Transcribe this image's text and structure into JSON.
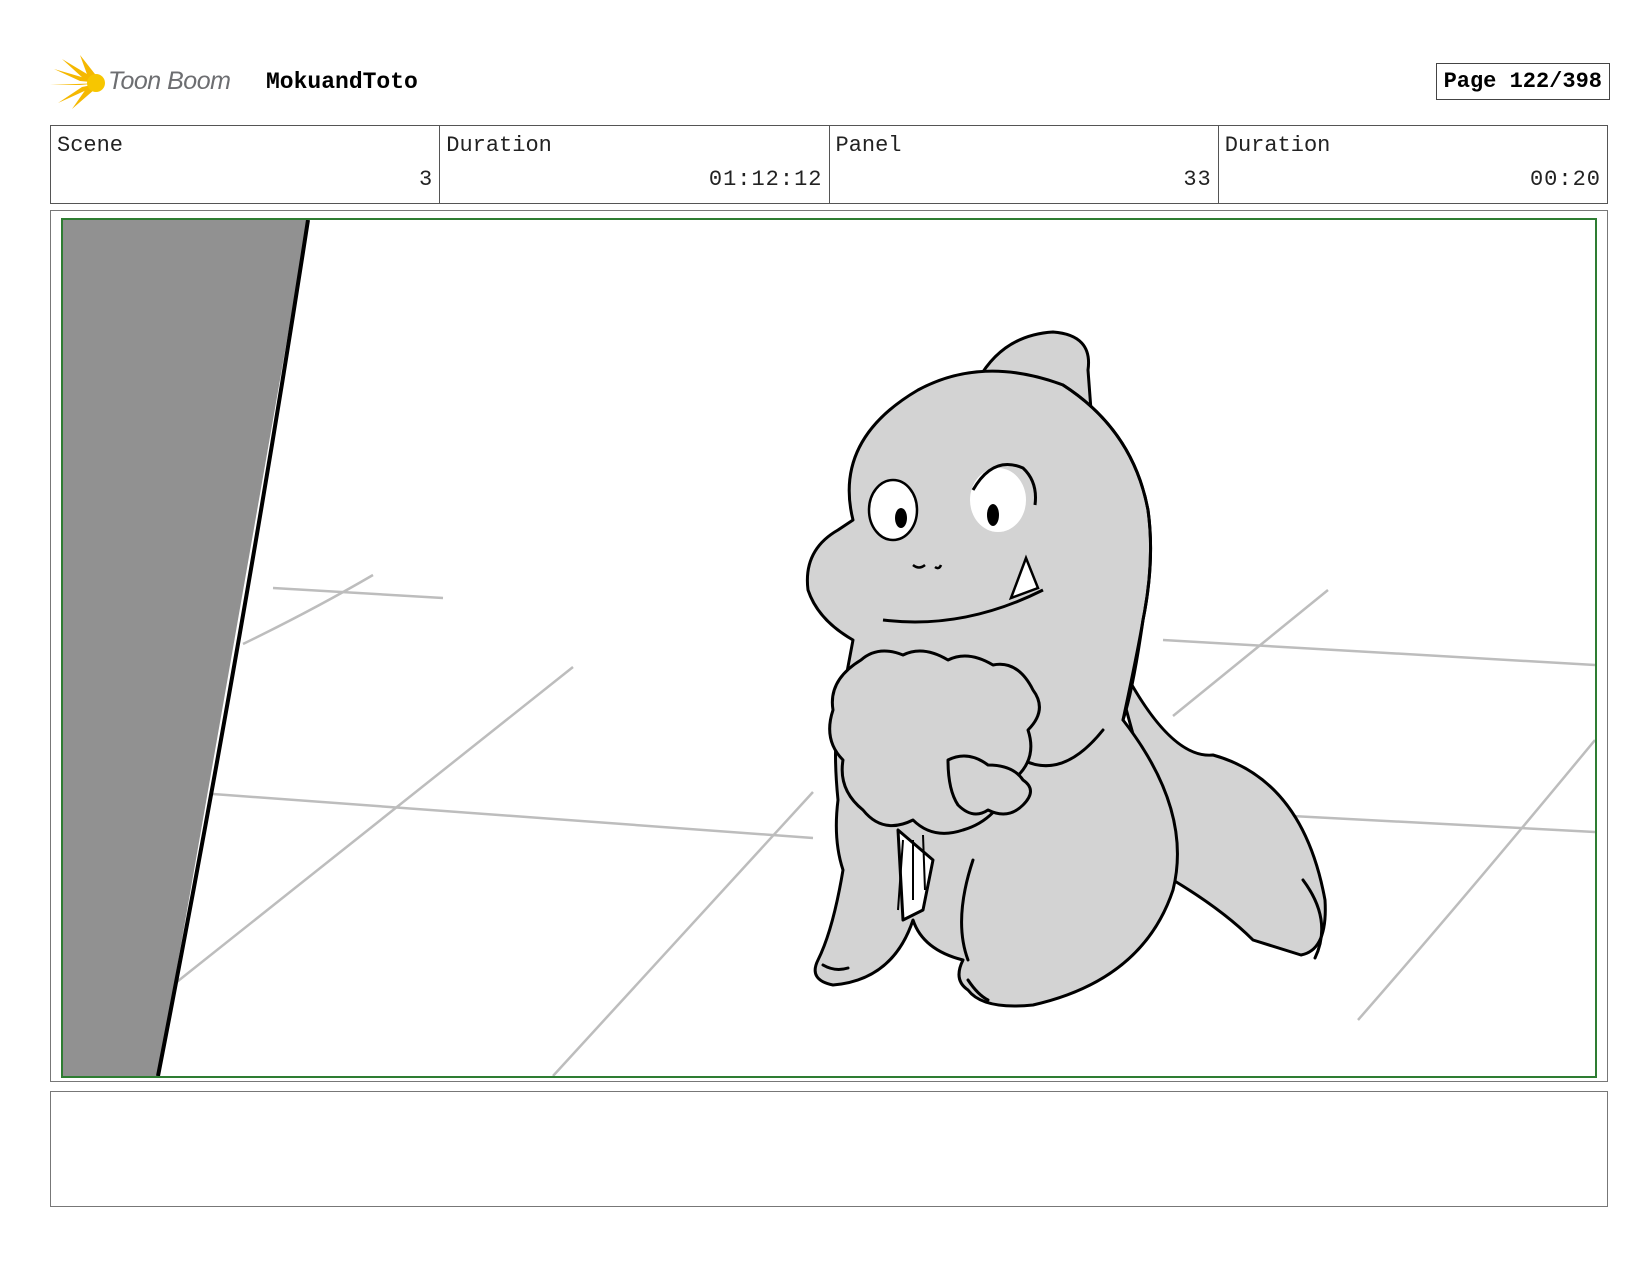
{
  "header": {
    "logo_text": "Toon Boom",
    "project_title": "MokuandToto",
    "page_label": "Page 122/398"
  },
  "info": [
    {
      "label": "Scene",
      "value": "3"
    },
    {
      "label": "Duration",
      "value": "01:12:12"
    },
    {
      "label": "Panel",
      "value": "33"
    },
    {
      "label": "Duration",
      "value": "00:20"
    }
  ],
  "panel": {
    "frame_color": "#2e7d32",
    "fill_gray": "#d3d3d3",
    "wall_gray": "#919191"
  },
  "notes": {
    "text": ""
  }
}
